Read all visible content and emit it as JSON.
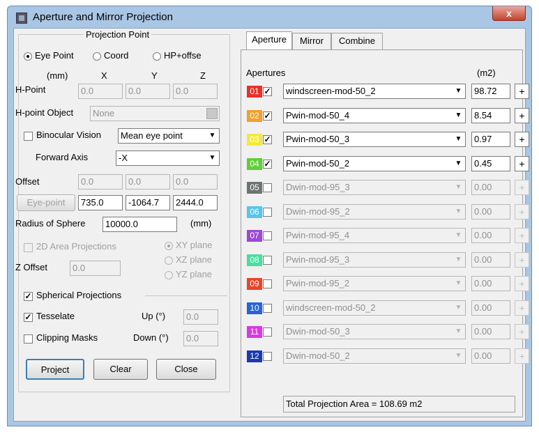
{
  "window": {
    "title": "Aperture and Mirror Projection",
    "close_glyph": "x"
  },
  "left": {
    "group_title": "Projection Point",
    "radios": [
      {
        "label": "Eye Point",
        "checked": true
      },
      {
        "label": "Coord",
        "checked": false
      },
      {
        "label": "HP+offse",
        "checked": false
      }
    ],
    "units_label": "(mm)",
    "axis_labels": [
      "X",
      "Y",
      "Z"
    ],
    "hpoint": {
      "label": "H-Point",
      "x": "0.0",
      "y": "0.0",
      "z": "0.0"
    },
    "hpoint_object": {
      "label": "H-point Object",
      "value": "None"
    },
    "binocular": {
      "label": "Binocular Vision",
      "checked": false,
      "value": "Mean eye point"
    },
    "forward_axis": {
      "label": "Forward Axis",
      "value": "-X"
    },
    "offset": {
      "label": "Offset",
      "x": "0.0",
      "y": "0.0",
      "z": "0.0"
    },
    "eyepoint": {
      "button": "Eye-point",
      "x": "735.0",
      "y": "-1064.7",
      "z": "2444.0"
    },
    "radius": {
      "label": "Radius of Sphere",
      "value": "10000.0",
      "unit": "(mm)"
    },
    "area_2d": {
      "label": "2D Area Projections",
      "checked": false
    },
    "planes": [
      {
        "label": "XY plane",
        "checked": true
      },
      {
        "label": "XZ plane",
        "checked": false
      },
      {
        "label": "YZ plane",
        "checked": false
      }
    ],
    "z_offset": {
      "label": "Z Offset",
      "value": "0.0"
    },
    "spherical": {
      "label": "Spherical Projections",
      "checked": true
    },
    "tesselate": {
      "label": "Tesselate",
      "checked": true
    },
    "up": {
      "label": "Up (°)",
      "value": "0.0"
    },
    "clipping": {
      "label": "Clipping Masks",
      "checked": false
    },
    "down": {
      "label": "Down (°)",
      "value": "0.0"
    },
    "buttons": {
      "project": "Project",
      "clear": "Clear",
      "close": "Close"
    }
  },
  "tabs": [
    {
      "label": "Aperture",
      "active": true
    },
    {
      "label": "Mirror",
      "active": false
    },
    {
      "label": "Combine",
      "active": false
    }
  ],
  "apertures": {
    "header": "Apertures",
    "unit_header": "(m2)",
    "plus_glyph": "+",
    "rows": [
      {
        "num": "01",
        "color": "#e8312a",
        "checked": true,
        "name": "windscreen-mod-50_2",
        "area": "98.72",
        "enabled": true
      },
      {
        "num": "02",
        "color": "#f0a02a",
        "checked": true,
        "name": "Pwin-mod-50_4",
        "area": "8.54",
        "enabled": true
      },
      {
        "num": "03",
        "color": "#f2ea3a",
        "checked": true,
        "name": "Pwin-mod-50_3",
        "area": "0.97",
        "enabled": true
      },
      {
        "num": "04",
        "color": "#5fcf36",
        "checked": true,
        "name": "Pwin-mod-50_2",
        "area": "0.45",
        "enabled": true
      },
      {
        "num": "05",
        "color": "#6e7470",
        "checked": false,
        "name": "Dwin-mod-95_3",
        "area": "0.00",
        "enabled": false
      },
      {
        "num": "06",
        "color": "#56c6ea",
        "checked": false,
        "name": "Dwin-mod-95_2",
        "area": "0.00",
        "enabled": false
      },
      {
        "num": "07",
        "color": "#9a4ad0",
        "checked": false,
        "name": "Pwin-mod-95_4",
        "area": "0.00",
        "enabled": false
      },
      {
        "num": "08",
        "color": "#46e0a0",
        "checked": false,
        "name": "Pwin-mod-95_3",
        "area": "0.00",
        "enabled": false
      },
      {
        "num": "09",
        "color": "#e8442a",
        "checked": false,
        "name": "Pwin-mod-95_2",
        "area": "0.00",
        "enabled": false
      },
      {
        "num": "10",
        "color": "#2a62d8",
        "checked": false,
        "name": "windscreen-mod-50_2",
        "area": "0.00",
        "enabled": false
      },
      {
        "num": "11",
        "color": "#d83ae0",
        "checked": false,
        "name": "Dwin-mod-50_3",
        "area": "0.00",
        "enabled": false
      },
      {
        "num": "12",
        "color": "#1a3ab0",
        "checked": false,
        "name": "Dwin-mod-50_2",
        "area": "0.00",
        "enabled": false
      }
    ],
    "total": "Total Projection Area = 108.69 m2"
  }
}
